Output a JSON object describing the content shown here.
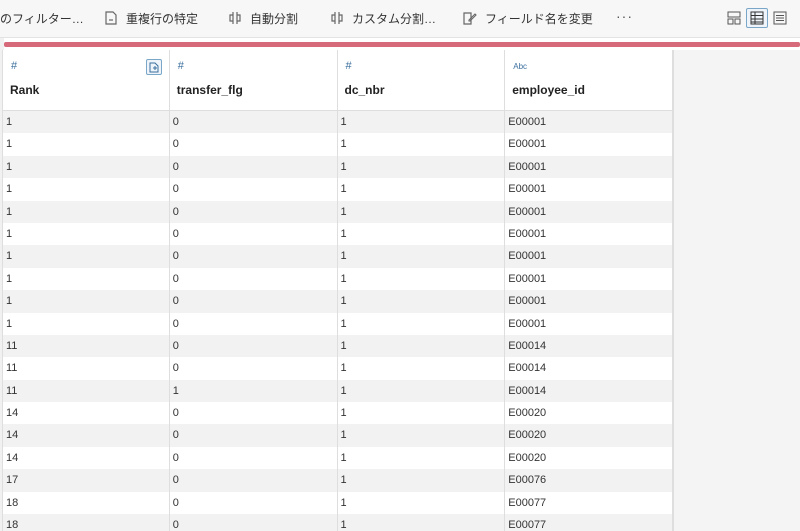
{
  "toolbar": {
    "items": [
      {
        "label": "のフィルター…",
        "icon": ""
      },
      {
        "label": "重複行の特定",
        "icon": "document-icon"
      },
      {
        "label": "自動分割",
        "icon": "split-icon"
      },
      {
        "label": "カスタム分割…",
        "icon": "split-icon"
      },
      {
        "label": "フィールド名を変更",
        "icon": "edit-icon"
      }
    ],
    "more": "···"
  },
  "columns": [
    {
      "type_icon": "#",
      "label": "Rank"
    },
    {
      "type_icon": "#",
      "label": "transfer_flg"
    },
    {
      "type_icon": "#",
      "label": "dc_nbr"
    },
    {
      "type_icon": "Abc",
      "label": "employee_id"
    }
  ],
  "rows": [
    [
      "1",
      "0",
      "1",
      "E00001"
    ],
    [
      "1",
      "0",
      "1",
      "E00001"
    ],
    [
      "1",
      "0",
      "1",
      "E00001"
    ],
    [
      "1",
      "0",
      "1",
      "E00001"
    ],
    [
      "1",
      "0",
      "1",
      "E00001"
    ],
    [
      "1",
      "0",
      "1",
      "E00001"
    ],
    [
      "1",
      "0",
      "1",
      "E00001"
    ],
    [
      "1",
      "0",
      "1",
      "E00001"
    ],
    [
      "1",
      "0",
      "1",
      "E00001"
    ],
    [
      "1",
      "0",
      "1",
      "E00001"
    ],
    [
      "11",
      "0",
      "1",
      "E00014"
    ],
    [
      "11",
      "0",
      "1",
      "E00014"
    ],
    [
      "11",
      "1",
      "1",
      "E00014"
    ],
    [
      "14",
      "0",
      "1",
      "E00020"
    ],
    [
      "14",
      "0",
      "1",
      "E00020"
    ],
    [
      "14",
      "0",
      "1",
      "E00020"
    ],
    [
      "17",
      "0",
      "1",
      "E00076"
    ],
    [
      "18",
      "0",
      "1",
      "E00077"
    ],
    [
      "18",
      "0",
      "1",
      "E00077"
    ]
  ],
  "colors": {
    "accent": "#d6697a",
    "type_icon": "#3b6f9e"
  }
}
